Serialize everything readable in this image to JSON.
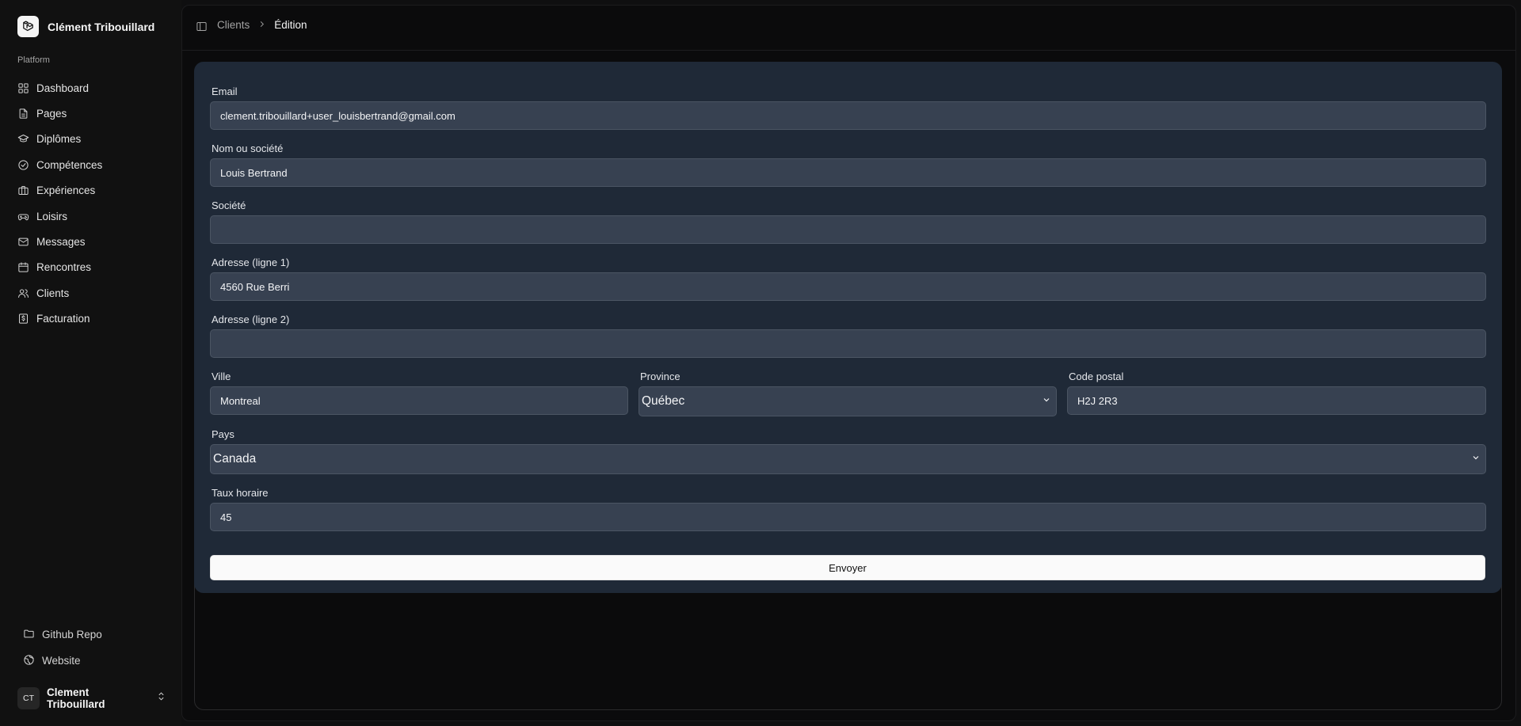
{
  "brand": {
    "name": "Clément Tribouillard"
  },
  "sidebar": {
    "heading": "Platform",
    "items": [
      {
        "label": "Dashboard",
        "icon": "grid-icon"
      },
      {
        "label": "Pages",
        "icon": "file-icon"
      },
      {
        "label": "Diplômes",
        "icon": "graduation-cap-icon"
      },
      {
        "label": "Compétences",
        "icon": "check-circle-icon"
      },
      {
        "label": "Expériences",
        "icon": "briefcase-icon"
      },
      {
        "label": "Loisirs",
        "icon": "gamepad-icon"
      },
      {
        "label": "Messages",
        "icon": "mail-icon"
      },
      {
        "label": "Rencontres",
        "icon": "calendar-icon"
      },
      {
        "label": "Clients",
        "icon": "users-icon"
      },
      {
        "label": "Facturation",
        "icon": "receipt-icon"
      }
    ],
    "footer": [
      {
        "label": "Github Repo",
        "icon": "folder-icon"
      },
      {
        "label": "Website",
        "icon": "globe-icon"
      }
    ],
    "user": {
      "initials": "CT",
      "name": "Clement Tribouillard"
    }
  },
  "breadcrumb": {
    "parent": "Clients",
    "current": "Édition"
  },
  "form": {
    "email": {
      "label": "Email",
      "value": "clement.tribouillard+user_louisbertrand@gmail.com"
    },
    "name": {
      "label": "Nom ou société",
      "value": "Louis Bertrand"
    },
    "company": {
      "label": "Société",
      "value": ""
    },
    "address1": {
      "label": "Adresse (ligne 1)",
      "value": "4560 Rue Berri"
    },
    "address2": {
      "label": "Adresse (ligne 2)",
      "value": ""
    },
    "city": {
      "label": "Ville",
      "value": "Montreal"
    },
    "province": {
      "label": "Province",
      "value": "Québec"
    },
    "postal": {
      "label": "Code postal",
      "value": "H2J 2R3"
    },
    "country": {
      "label": "Pays",
      "value": "Canada"
    },
    "rate": {
      "label": "Taux horaire",
      "value": "45"
    },
    "submit": "Envoyer"
  }
}
